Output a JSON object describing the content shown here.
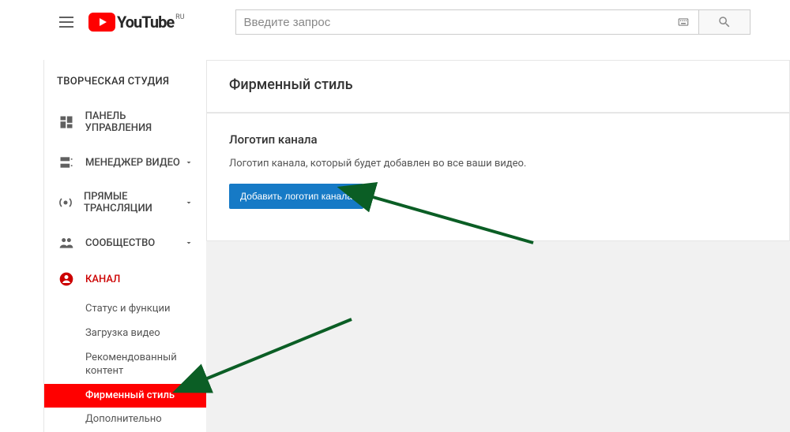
{
  "header": {
    "logo_text": "YouTube",
    "logo_locale": "RU",
    "search_placeholder": "Введите запрос"
  },
  "sidebar": {
    "title": "ТВОРЧЕСКАЯ СТУДИЯ",
    "items": [
      {
        "label": "ПАНЕЛЬ УПРАВЛЕНИЯ"
      },
      {
        "label": "МЕНЕДЖЕР ВИДЕО"
      },
      {
        "label": "ПРЯМЫЕ ТРАНСЛЯЦИИ"
      },
      {
        "label": "СООБЩЕСТВО"
      },
      {
        "label": "КАНАЛ"
      }
    ],
    "channel_sub": [
      {
        "label": "Статус и функции"
      },
      {
        "label": "Загрузка видео"
      },
      {
        "label": "Рекомендованный контент"
      },
      {
        "label": "Фирменный стиль"
      },
      {
        "label": "Дополнительно"
      }
    ]
  },
  "main": {
    "heading": "Фирменный стиль",
    "section_title": "Логотип канала",
    "section_desc": "Логотип канала, который будет добавлен во все ваши видео.",
    "button_label": "Добавить логотип канала"
  }
}
